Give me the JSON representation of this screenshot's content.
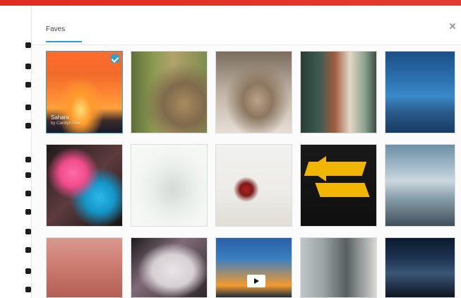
{
  "app": {
    "top_bar_color": "#e02b20"
  },
  "panel": {
    "tab_label": "Faves",
    "close_icon": "close-icon"
  },
  "grid": {
    "items": [
      {
        "caption_title": "Sahara",
        "caption_sub": "by Carolyn Eva",
        "selected": true
      }
    ]
  }
}
